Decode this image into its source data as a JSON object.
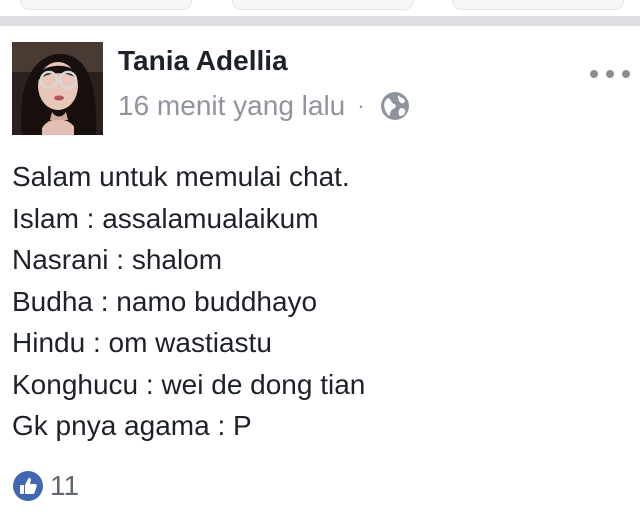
{
  "post": {
    "author": "Tania Adellia",
    "timestamp": "16 menit yang lalu",
    "separator": "·",
    "audience_icon": "globe-icon",
    "more_icon": "more-options-icon",
    "lines": [
      "Salam untuk memulai chat.",
      "Islam : assalamualaikum",
      "Nasrani : shalom",
      "Budha : namo buddhayo",
      "Hindu : om wastiastu",
      "Konghucu : wei de dong tian",
      "Gk pnya agama : P"
    ],
    "reactions": {
      "icon": "like-icon",
      "count": "11"
    }
  },
  "colors": {
    "name_text": "#1d2129",
    "meta_text": "#90949c",
    "like_blue": "#4267b2",
    "divider": "#dddfe2"
  }
}
